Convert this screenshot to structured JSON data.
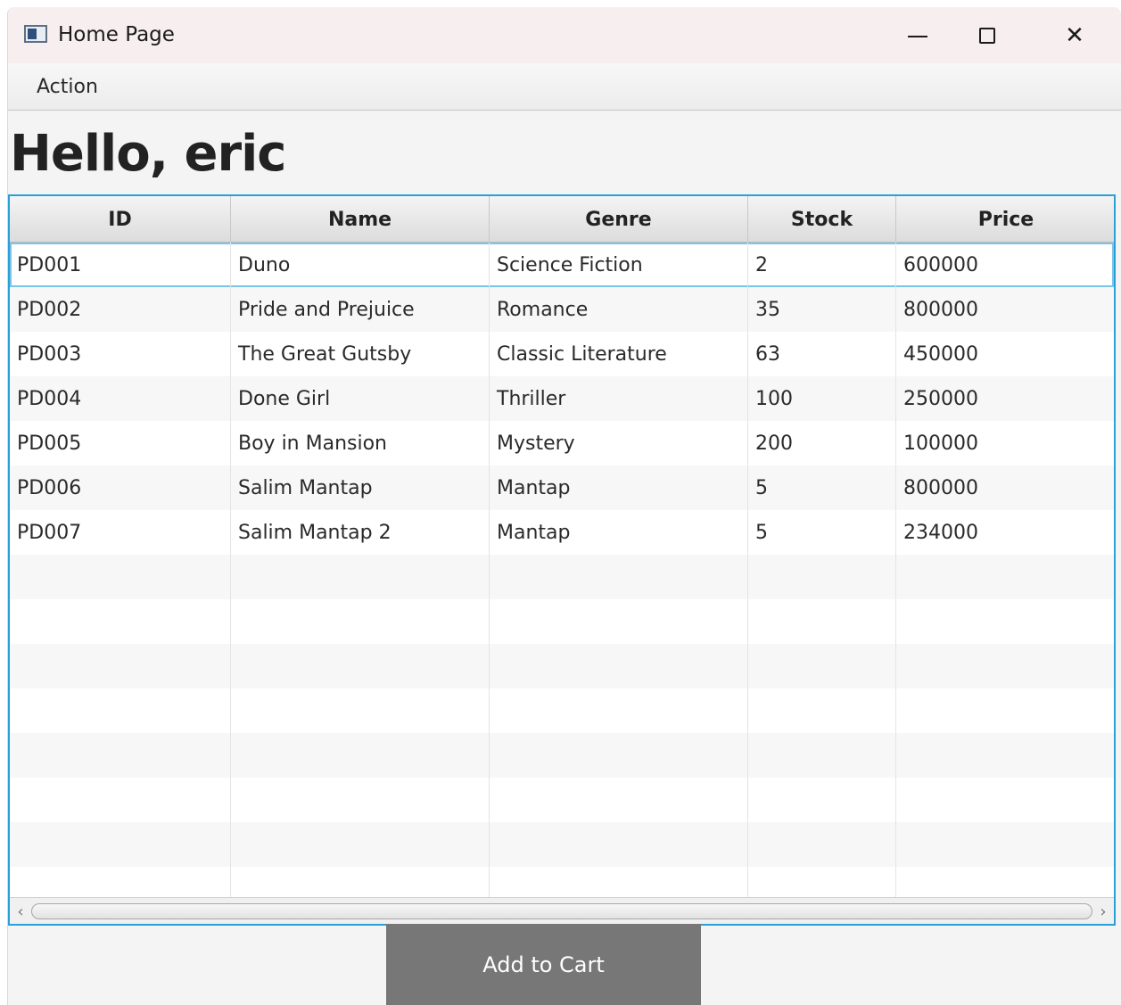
{
  "window": {
    "title": "Home Page"
  },
  "menubar": {
    "items": [
      {
        "label": "Action"
      }
    ]
  },
  "greeting": "Hello, eric",
  "table": {
    "columns": [
      "ID",
      "Name",
      "Genre",
      "Stock",
      "Price"
    ],
    "rows": [
      [
        "PD001",
        "Duno",
        "Science Fiction",
        "2",
        "600000"
      ],
      [
        "PD002",
        "Pride and Prejuice",
        "Romance",
        "35",
        "800000"
      ],
      [
        "PD003",
        "The Great Gutsby",
        "Classic Literature",
        "63",
        "450000"
      ],
      [
        "PD004",
        "Done Girl",
        "Thriller",
        "100",
        "250000"
      ],
      [
        "PD005",
        "Boy in Mansion",
        "Mystery",
        "200",
        "100000"
      ],
      [
        "PD006",
        "Salim Mantap",
        "Mantap",
        "5",
        "800000"
      ],
      [
        "PD007",
        "Salim Mantap 2",
        "Mantap",
        "5",
        "234000"
      ]
    ],
    "selected_row": 0
  },
  "add_button_label": "Add to Cart",
  "colors": {
    "accent": "#2aa0d8",
    "button": "#777777",
    "titlebar": "#f7eef0"
  }
}
